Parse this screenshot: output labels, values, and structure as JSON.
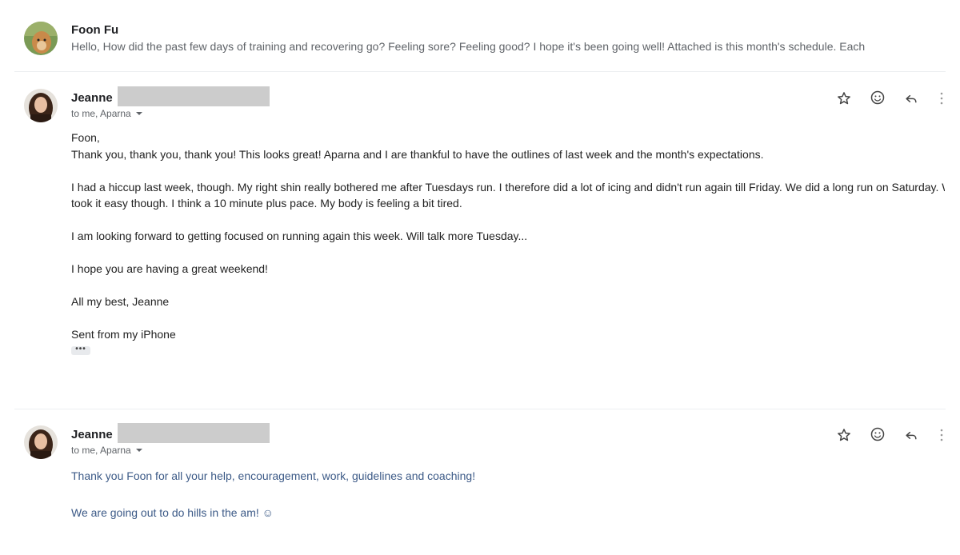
{
  "collapsed_message": {
    "sender": "Foon Fu",
    "snippet": "Hello, How did the past few days of training and recovering go? Feeling sore? Feeling good? I hope it's been going well! Attached is this month's schedule. Each"
  },
  "message1": {
    "sender": "Jeanne",
    "recipients": "to me, Aparna",
    "body": {
      "greeting": "Foon,",
      "line1": "Thank you, thank you, thank you!  This looks great!  Aparna and I are thankful to have the outlines of last week and the month's expectations.",
      "para2_line1": "I had a hiccup last week, though.  My right shin really bothered me after Tuesdays run.  I therefore did a lot of icing and didn't run again till Friday.  We did a long run on Saturday.  We",
      "para2_line2": "took it easy though.  I think a 10 minute plus pace.  My body is feeling a bit tired.",
      "para3": "I am looking forward to getting focused on running again this week.  Will talk more Tuesday...",
      "para4": "I hope you are having a great weekend!",
      "para5": "All my best, Jeanne",
      "signature": "Sent from my iPhone"
    },
    "trimmed_content_label": "•••"
  },
  "message2": {
    "sender": "Jeanne",
    "recipients": "to me, Aparna",
    "body": {
      "line1": "Thank you Foon for all your help, encouragement, work, guidelines and coaching!",
      "line2": "We are going out to do hills in the am! ☺"
    }
  },
  "icons": [
    "star-icon",
    "emoji-react-icon",
    "reply-icon",
    "more-vert-icon"
  ],
  "colors": {
    "sender": "#202124",
    "secondary_text": "#5f6368",
    "redaction": "#cccccc",
    "message2_text": "#3c5a87"
  }
}
